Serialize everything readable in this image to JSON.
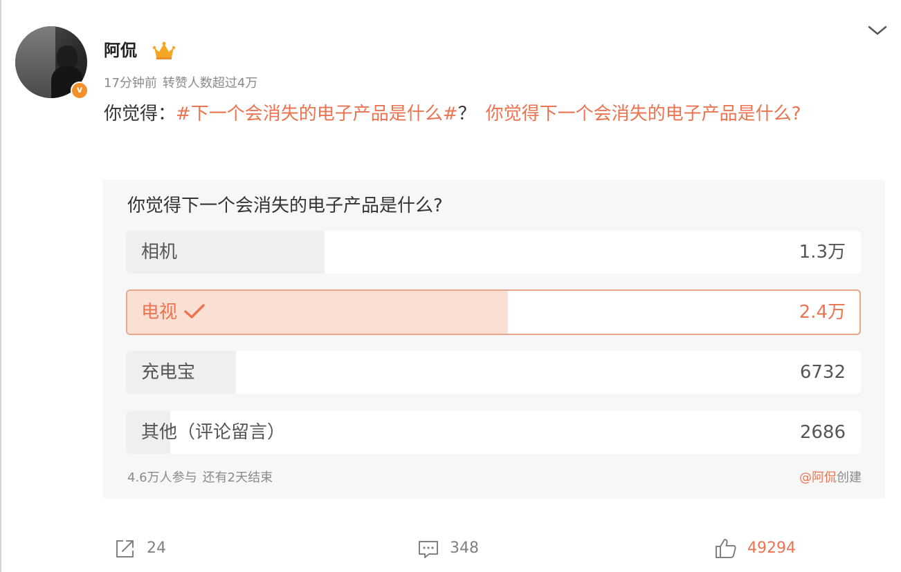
{
  "post": {
    "author": "阿侃",
    "time": "17分钟前",
    "reposts_note": "转赞人数超过4万",
    "text_prefix": "你觉得：",
    "topic": "#下一个会消失的电子产品是什么#",
    "text_middle": "？",
    "link_text": "你觉得下一个会消失的电子产品是什么?"
  },
  "poll": {
    "title": "你觉得下一个会消失的电子产品是什么?",
    "options": [
      {
        "label": "相机",
        "count": "1.3万",
        "share": 0.27,
        "selected": false
      },
      {
        "label": "电视",
        "count": "2.4万",
        "share": 0.52,
        "selected": true
      },
      {
        "label": "充电宝",
        "count": "6732",
        "share": 0.15,
        "selected": false
      },
      {
        "label": "其他（评论留言）",
        "count": "2686",
        "share": 0.06,
        "selected": false
      }
    ],
    "participants": "4.6万人参与",
    "remaining": "还有2天结束",
    "creator": "@阿侃",
    "created_label": "创建"
  },
  "actions": {
    "repost_count": "24",
    "comment_count": "348",
    "like_count": "49294"
  },
  "colors": {
    "accent": "#eb7350",
    "badge": "#f58f2a",
    "selected_fill": "#fae0d4",
    "option_fill": "#efefef"
  },
  "icons": [
    "crown-icon",
    "verified-badge-icon",
    "chevron-down-icon",
    "check-icon",
    "repost-icon",
    "comment-icon",
    "like-icon"
  ]
}
